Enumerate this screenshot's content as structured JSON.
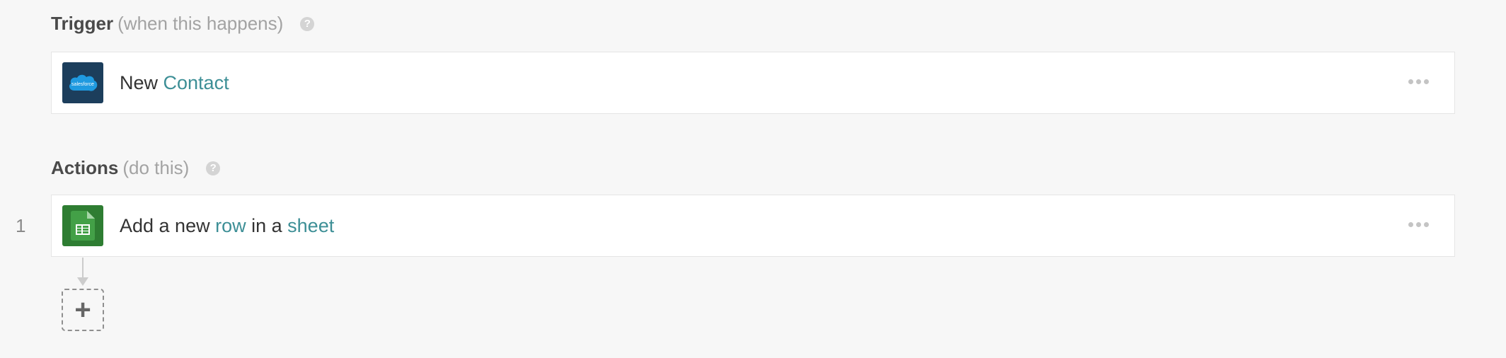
{
  "trigger": {
    "title": "Trigger",
    "subtitle": "(when this happens)",
    "help_icon": "?",
    "card": {
      "app_icon": "salesforce-icon",
      "app_icon_text": "salesforce",
      "text_plain": "New ",
      "text_link": "Contact",
      "menu_icon": "more-horizontal-icon"
    }
  },
  "actions": {
    "title": "Actions",
    "subtitle": "(do this)",
    "help_icon": "?",
    "steps": [
      {
        "number": "1",
        "app_icon": "google-sheets-icon",
        "parts": [
          "Add a new ",
          "row",
          " in a ",
          "sheet"
        ],
        "menu_icon": "more-horizontal-icon"
      }
    ],
    "add_step_label": "+"
  },
  "colors": {
    "background": "#f7f7f7",
    "link": "#3d8f96",
    "salesforce_tile": "#1c3e5c",
    "salesforce_cloud": "#1f9ae0",
    "sheets_tile": "#2e7d32"
  }
}
